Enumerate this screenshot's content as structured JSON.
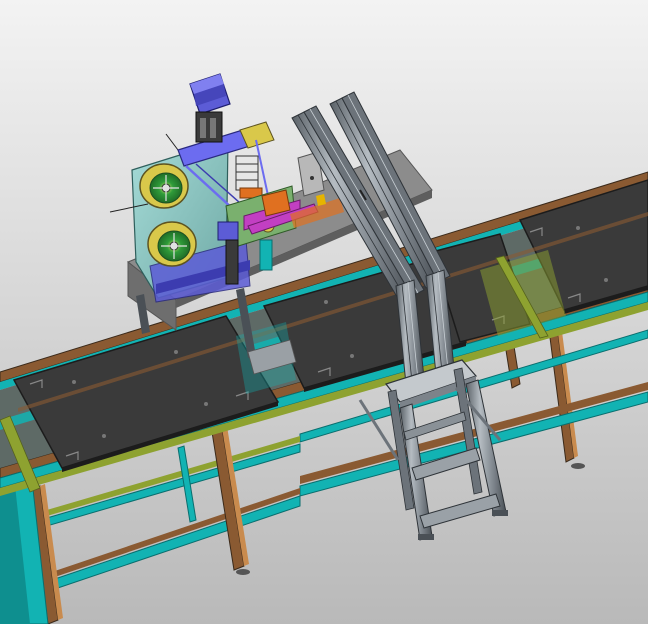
{
  "scene": {
    "subject": "cad-assembly-conveyor-workstation",
    "background_top": "#f3f3f3",
    "background_bottom": "#b9b9b9"
  },
  "colors": {
    "plate_dark": "#3a3a3a",
    "plate_edge": "#1c1c1c",
    "rail_brown": "#8a5a32",
    "rail_cyan": "#12b3b3",
    "rail_olive": "#8ea230",
    "aluminium": "#8e959b",
    "aluminium_dark": "#4a5056",
    "machine_teal": "#8fc7c4",
    "reel_yellow": "#d9c84a",
    "reel_green": "#2f9b3a",
    "motor_blue": "#5c5cd6",
    "accent_magenta": "#c23fc2",
    "accent_orange": "#e07020",
    "base_plate_grey": "#8c8c8c"
  }
}
